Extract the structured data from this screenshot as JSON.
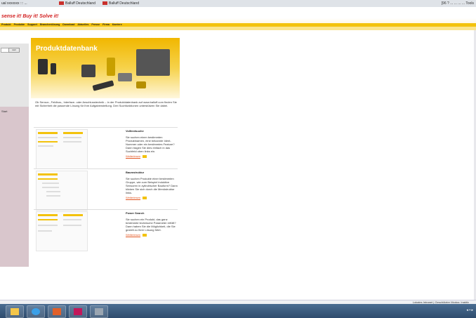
{
  "window": {
    "tabs": [
      {
        "label": "ual xxxxxxx ::: ..."
      },
      {
        "label": "Balluff Deutschland"
      },
      {
        "label": "Balluff Deutschland"
      }
    ],
    "controls_text": "[96   ?   ...   ...   ...   ...   Tools"
  },
  "banner": {
    "slogan": "sense it! Buy it! Solve it!"
  },
  "nav": {
    "items": [
      "Produkt",
      "Produkte",
      "Support",
      "Branchenlösung",
      "Download",
      "Aktuelles",
      "Presse",
      "Firma",
      "Karriere"
    ]
  },
  "sidebar": {
    "search_button": "start",
    "item": "Start"
  },
  "page": {
    "title": "Produktdatenbank",
    "intro": "Ob Sensor-, Feldbus-, Interface- oder Anschlusstechnik – in der Produktdatenbank auf www.balluff.com finden Sie mit Sicherheit die passende Lösung für Ihre Aufgabenstellung. Drei Suchfunktionen unterstützen Sie dabei.",
    "sections": [
      {
        "title": "Volltextsuche",
        "text": "Sie suchen einen bestimmten Produktnamen, eine bekannte Ident-Nummer oder ein bestimmtes Feature? Dann tragen Sie dies einfach in das Suchfeld oben links ein.",
        "link": "Weiterlesen"
      },
      {
        "title": "Baumstruktur",
        "text": "Sie suchen Produkte einer bestimmten Gruppe, wie zum Beispiel induktive Sensoren in zylindrischer Bauform? Dann klicken Sie sich durch die Menüstruktur links.",
        "link": "Weiterlesen"
      },
      {
        "title": "Power Search",
        "text": "Sie suchen ein Produkt, das ganz bestimmte technische Parameter erfüllt? Dann haben Sie die Möglichkeit, die Sie gezielt zu Ihrer Lösung führt.",
        "link": "Weiterlesen"
      }
    ]
  },
  "statusbar": {
    "zone": "Lokales Intranet | Geschützter Modus: Inaktiv"
  },
  "colors": {
    "brand_yellow": "#f3c20c",
    "brand_red": "#d21f1f",
    "link_orange": "#e2541f"
  }
}
